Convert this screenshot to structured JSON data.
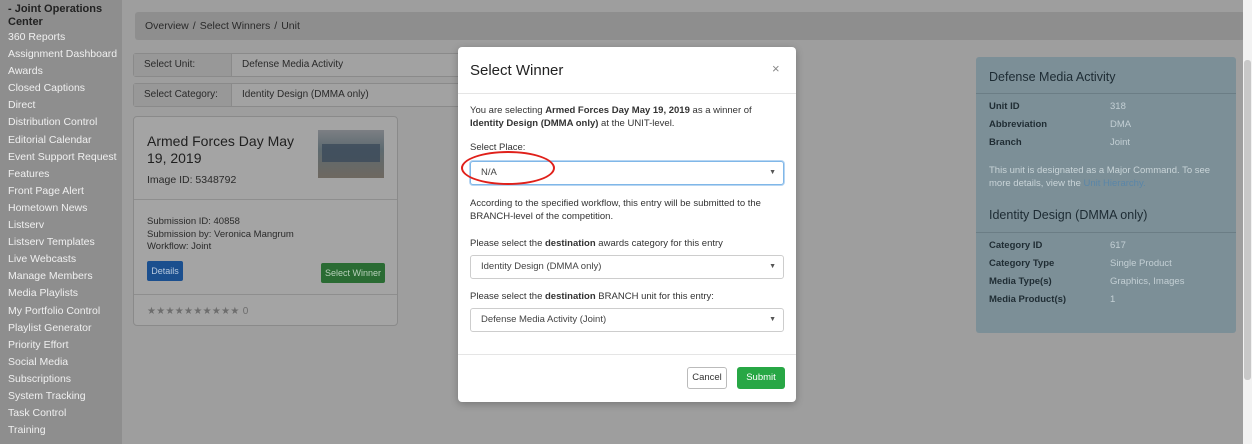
{
  "sidebar": {
    "header": "- Joint Operations Center",
    "items": [
      "360 Reports",
      "Assignment Dashboard",
      "Awards",
      "Closed Captions",
      "Direct",
      "Distribution Control",
      "Editorial Calendar",
      "Event Support Request",
      "Features",
      "Front Page Alert",
      "Hometown News",
      "Listserv",
      "Listserv Templates",
      "Live Webcasts",
      "Manage Members",
      "Media Playlists",
      "My Portfolio Control",
      "Playlist Generator",
      "Priority Effort",
      "Social Media",
      "Subscriptions",
      "System Tracking",
      "Task Control",
      "Training"
    ]
  },
  "breadcrumb": {
    "items": [
      "Overview",
      "Select Winners",
      "Unit"
    ],
    "separator": "/"
  },
  "unit_field": {
    "label": "Select Unit:",
    "value": "Defense Media Activity"
  },
  "category_field": {
    "label": "Select Category:",
    "value": "Identity Design (DMMA only)"
  },
  "card": {
    "title": "Armed Forces Day May 19, 2019",
    "image_id": "Image ID: 5348792",
    "submission_id": "Submission ID: 40858",
    "submitted_by": "Submission by: Veronica Mangrum",
    "workflow": "Workflow: Joint",
    "details_label": "Details",
    "select_winner_label": "Select Winner",
    "stars": "★★★★★★★★★★",
    "rating": "0"
  },
  "right_panel": {
    "unit_title": "Defense Media Activity",
    "unit_rows": [
      {
        "k": "Unit ID",
        "v": "318"
      },
      {
        "k": "Abbreviation",
        "v": "DMA"
      },
      {
        "k": "Branch",
        "v": "Joint"
      }
    ],
    "note_text": "This unit is designated as a Major Command. To see more details, view the ",
    "note_link": "Unit Hierarchy.",
    "category_title": "Identity Design (DMMA only)",
    "category_rows": [
      {
        "k": "Category ID",
        "v": "617"
      },
      {
        "k": "Category Type",
        "v": "Single Product"
      },
      {
        "k": "Media Type(s)",
        "v": "Graphics, Images"
      },
      {
        "k": "Media Product(s)",
        "v": "1"
      }
    ]
  },
  "modal": {
    "title": "Select Winner",
    "close": "×",
    "intro_1": "You are selecting ",
    "intro_entry": "Armed Forces Day May 19, 2019",
    "intro_2": " as a winner of ",
    "intro_category": "Identity Design (DMMA only)",
    "intro_3": " at the UNIT-level.",
    "place_label": "Select Place:",
    "place_value": "N/A",
    "workflow_text": "According to the specified workflow, this entry will be submitted to the BRANCH-level of the competition.",
    "dest_cat_1": "Please select the ",
    "dest_word": "destination",
    "dest_cat_2": " awards category for this entry",
    "dest_cat_value": "Identity Design (DMMA only)",
    "dest_unit_2": " BRANCH unit for this entry:",
    "dest_unit_value": "Defense Media Activity (Joint)",
    "cancel_label": "Cancel",
    "submit_label": "Submit",
    "arrow": "▼"
  }
}
